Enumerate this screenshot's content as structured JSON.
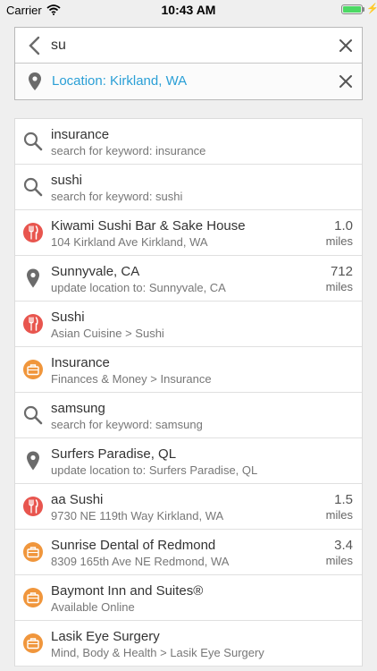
{
  "status_bar": {
    "carrier": "Carrier",
    "time": "10:43 AM",
    "battery_level": 1.0
  },
  "search": {
    "query": "su",
    "location": "Location: Kirkland, WA",
    "back_icon": "chevron-left-icon",
    "location_icon": "map-pin-icon",
    "clear_icon": "close-icon"
  },
  "colors": {
    "accent": "#2a9fd6",
    "restaurant": "#e8554e",
    "business": "#f0963c",
    "icon_gray": "#6b6b6b"
  },
  "results": [
    {
      "type": "keyword",
      "icon": "search-icon",
      "title": "insurance",
      "subtitle": "search for keyword: insurance",
      "distance": "",
      "unit": ""
    },
    {
      "type": "keyword",
      "icon": "search-icon",
      "title": "sushi",
      "subtitle": "search for keyword: sushi",
      "distance": "",
      "unit": ""
    },
    {
      "type": "restaurant",
      "icon": "fork-knife-icon",
      "title": "Kiwami Sushi Bar & Sake House",
      "subtitle": "104 Kirkland Ave Kirkland, WA",
      "distance": "1.0",
      "unit": "miles"
    },
    {
      "type": "location",
      "icon": "map-pin-icon",
      "title": "Sunnyvale, CA",
      "subtitle": "update location to: Sunnyvale, CA",
      "distance": "712",
      "unit": "miles"
    },
    {
      "type": "restaurant",
      "icon": "fork-knife-icon",
      "title": "Sushi",
      "subtitle": "Asian Cuisine > Sushi",
      "distance": "",
      "unit": ""
    },
    {
      "type": "business",
      "icon": "briefcase-icon",
      "title": "Insurance",
      "subtitle": "Finances & Money > Insurance",
      "distance": "",
      "unit": ""
    },
    {
      "type": "keyword",
      "icon": "search-icon",
      "title": "samsung",
      "subtitle": "search for keyword: samsung",
      "distance": "",
      "unit": ""
    },
    {
      "type": "location",
      "icon": "map-pin-icon",
      "title": "Surfers Paradise, QL",
      "subtitle": "update location to: Surfers Paradise, QL",
      "distance": "",
      "unit": ""
    },
    {
      "type": "restaurant",
      "icon": "fork-knife-icon",
      "title": "aa Sushi",
      "subtitle": "9730 NE 119th Way Kirkland, WA",
      "distance": "1.5",
      "unit": "miles"
    },
    {
      "type": "business",
      "icon": "briefcase-icon",
      "title": "Sunrise Dental of Redmond",
      "subtitle": "8309 165th Ave NE Redmond, WA",
      "distance": "3.4",
      "unit": "miles"
    },
    {
      "type": "business",
      "icon": "briefcase-icon",
      "title": "Baymont Inn and Suites®",
      "subtitle": "Available Online",
      "distance": "",
      "unit": ""
    },
    {
      "type": "business",
      "icon": "briefcase-icon",
      "title": "Lasik Eye Surgery",
      "subtitle": "Mind, Body & Health > Lasik Eye Surgery",
      "distance": "",
      "unit": ""
    }
  ]
}
